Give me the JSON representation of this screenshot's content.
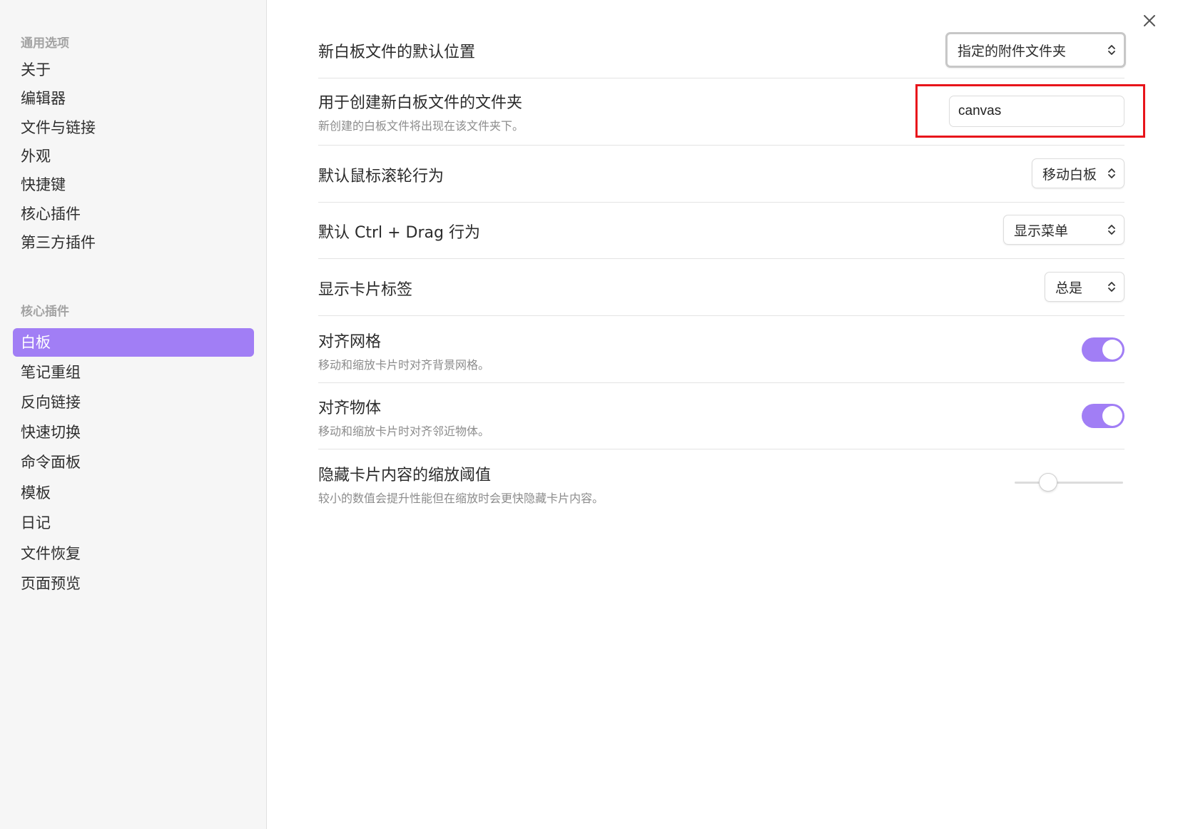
{
  "sidebar": {
    "general_heading": "通用选项",
    "general_items": [
      "关于",
      "编辑器",
      "文件与链接",
      "外观",
      "快捷键",
      "核心插件",
      "第三方插件"
    ],
    "core_heading": "核心插件",
    "core_items": [
      "白板",
      "笔记重组",
      "反向链接",
      "快速切换",
      "命令面板",
      "模板",
      "日记",
      "文件恢复",
      "页面预览"
    ],
    "active_item": "白板"
  },
  "settings": {
    "default_location": {
      "title": "新白板文件的默认位置",
      "value": "指定的附件文件夹"
    },
    "folder": {
      "title": "用于创建新白板文件的文件夹",
      "desc": "新创建的白板文件将出现在该文件夹下。",
      "value": "canvas"
    },
    "scroll": {
      "title": "默认鼠标滚轮行为",
      "value": "移动白板"
    },
    "ctrl_drag": {
      "title": "默认 Ctrl + Drag 行为",
      "value": "显示菜单"
    },
    "card_label": {
      "title": "显示卡片标签",
      "value": "总是"
    },
    "snap_grid": {
      "title": "对齐网格",
      "desc": "移动和缩放卡片时对齐背景网格。",
      "enabled": true
    },
    "snap_objects": {
      "title": "对齐物体",
      "desc": "移动和缩放卡片时对齐邻近物体。",
      "enabled": true
    },
    "zoom_threshold": {
      "title": "隐藏卡片内容的缩放阈值",
      "desc": "较小的数值会提升性能但在缩放时会更快隐藏卡片内容。",
      "value_fraction": 0.27
    }
  },
  "colors": {
    "accent": "#a17ef5",
    "highlight_box": "#e8141b"
  },
  "icons": {
    "close": "close-icon",
    "select_chevron": "chevron-up-down-icon"
  }
}
